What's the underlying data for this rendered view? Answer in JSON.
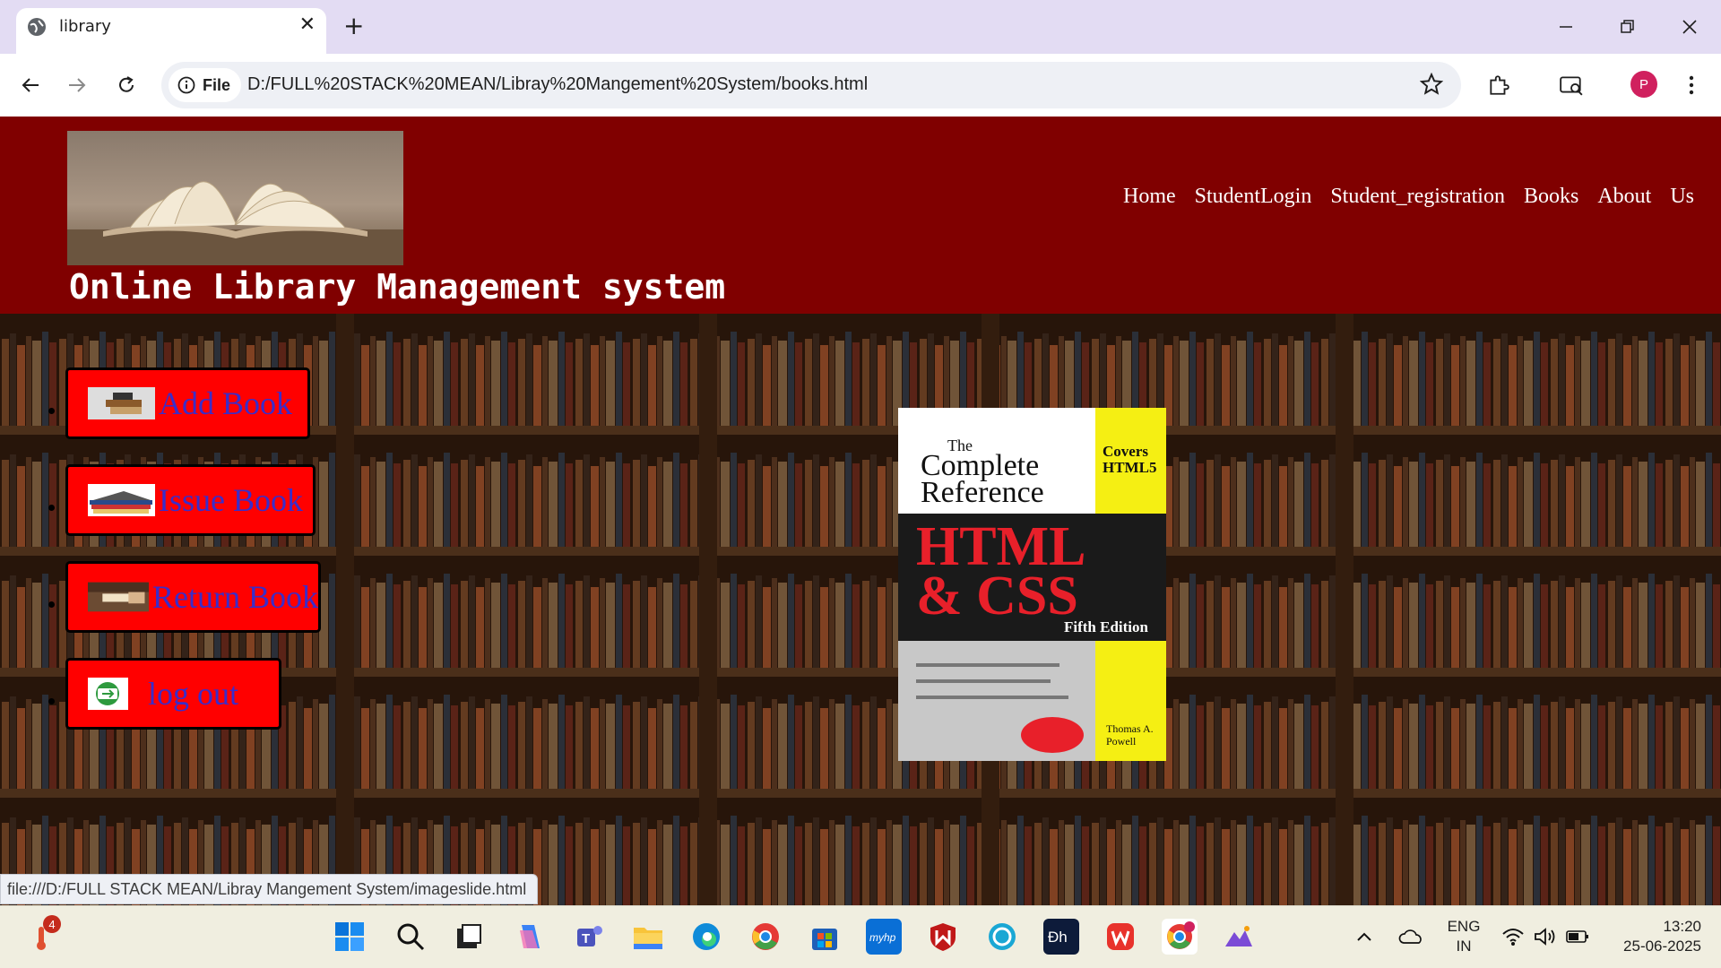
{
  "browser": {
    "tab_title": "library",
    "new_tab_symbol": "+",
    "site_chip_label": "File",
    "url": "D:/FULL%20STACK%20MEAN/Libray%20Mangement%20System/books.html",
    "profile_initial": "P",
    "status_url": "file:///D:/FULL STACK MEAN/Libray Mangement System/imageslide.html"
  },
  "site": {
    "title": "Online Library Management system",
    "nav": [
      "Home",
      "StudentLogin",
      "Student_registration",
      "Books",
      "About",
      "Us"
    ]
  },
  "sidebar": {
    "buttons": [
      {
        "label": "Add Book",
        "icon": "books-thumbnail"
      },
      {
        "label": "Issue Book",
        "icon": "book-stack-thumbnail"
      },
      {
        "label": "Return Book",
        "icon": "handover-thumbnail"
      },
      {
        "label": "log out",
        "icon": "logout-thumbnail"
      }
    ]
  },
  "book_cover": {
    "the": "The",
    "complete": "Complete",
    "reference": "Reference",
    "covers": "Covers",
    "html5": "HTML5",
    "title_line1": "HTML",
    "title_line2": "& CSS",
    "edition": "Fifth Edition",
    "author_line1": "Thomas A.",
    "author_line2": "Powell"
  },
  "taskbar": {
    "notification_count": "4",
    "language_line1": "ENG",
    "language_line2": "IN",
    "time": "13:20",
    "date": "25-06-2025",
    "apps": [
      "windows-start",
      "search",
      "task-view",
      "copilot",
      "teams",
      "file-explorer",
      "edge",
      "chrome",
      "microsoft-store",
      "myhp",
      "mcafee",
      "alexa",
      "dh-app",
      "wps-office",
      "chrome-profile",
      "photos"
    ]
  },
  "colors": {
    "header_bg": "#800000",
    "button_bg": "#ff0000",
    "button_text": "#3a2dc9",
    "browser_frame": "#e3dcf3"
  }
}
